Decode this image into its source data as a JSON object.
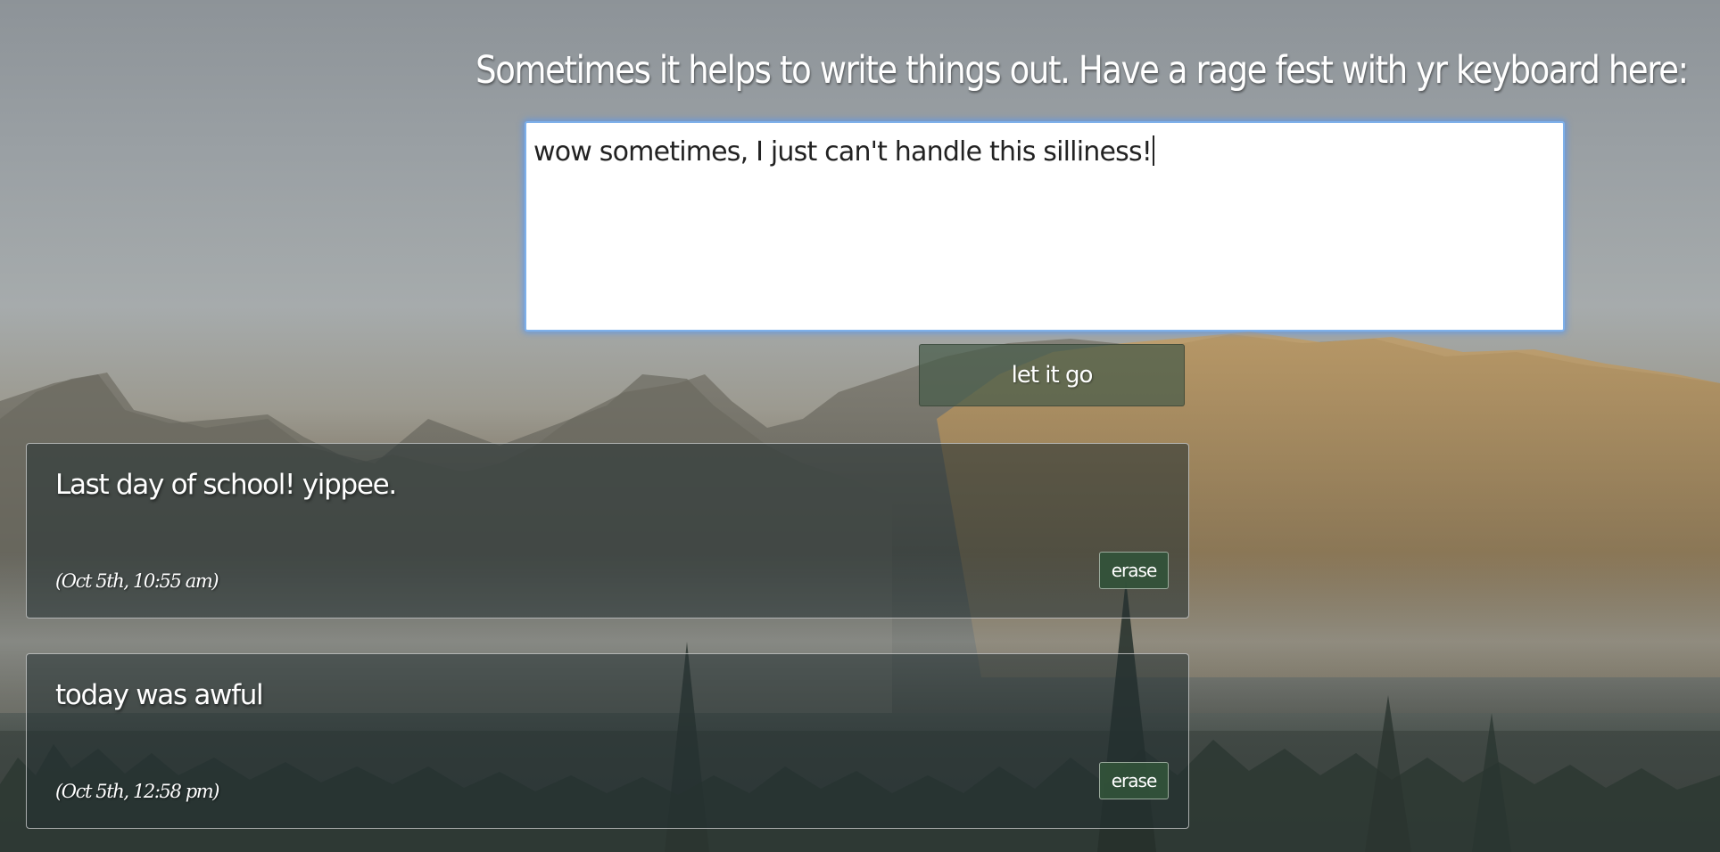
{
  "header": {
    "prompt": "Sometimes it helps to write things out. Have a rage fest with yr keyboard here:"
  },
  "composer": {
    "value": "wow sometimes, I just can't handle this silliness!",
    "submit_label": "let it go"
  },
  "entries": [
    {
      "text": "Last day of school! yippee.",
      "timestamp": "(Oct 5th, 10:55 am)",
      "erase_label": "erase"
    },
    {
      "text": "today was awful",
      "timestamp": "(Oct 5th, 12:58 pm)",
      "erase_label": "erase"
    }
  ],
  "background": {
    "subject": "misty mountain landscape with pine forest",
    "colors": {
      "sky": "#9aa0a4",
      "mountain_sunlit": "#b08a55",
      "mountain_shadow": "#5a5a52",
      "forest": "#2f3a35"
    }
  },
  "colors": {
    "focus_ring": "#7eb0ea",
    "button_green": "#32523a",
    "panel": "#223032"
  }
}
